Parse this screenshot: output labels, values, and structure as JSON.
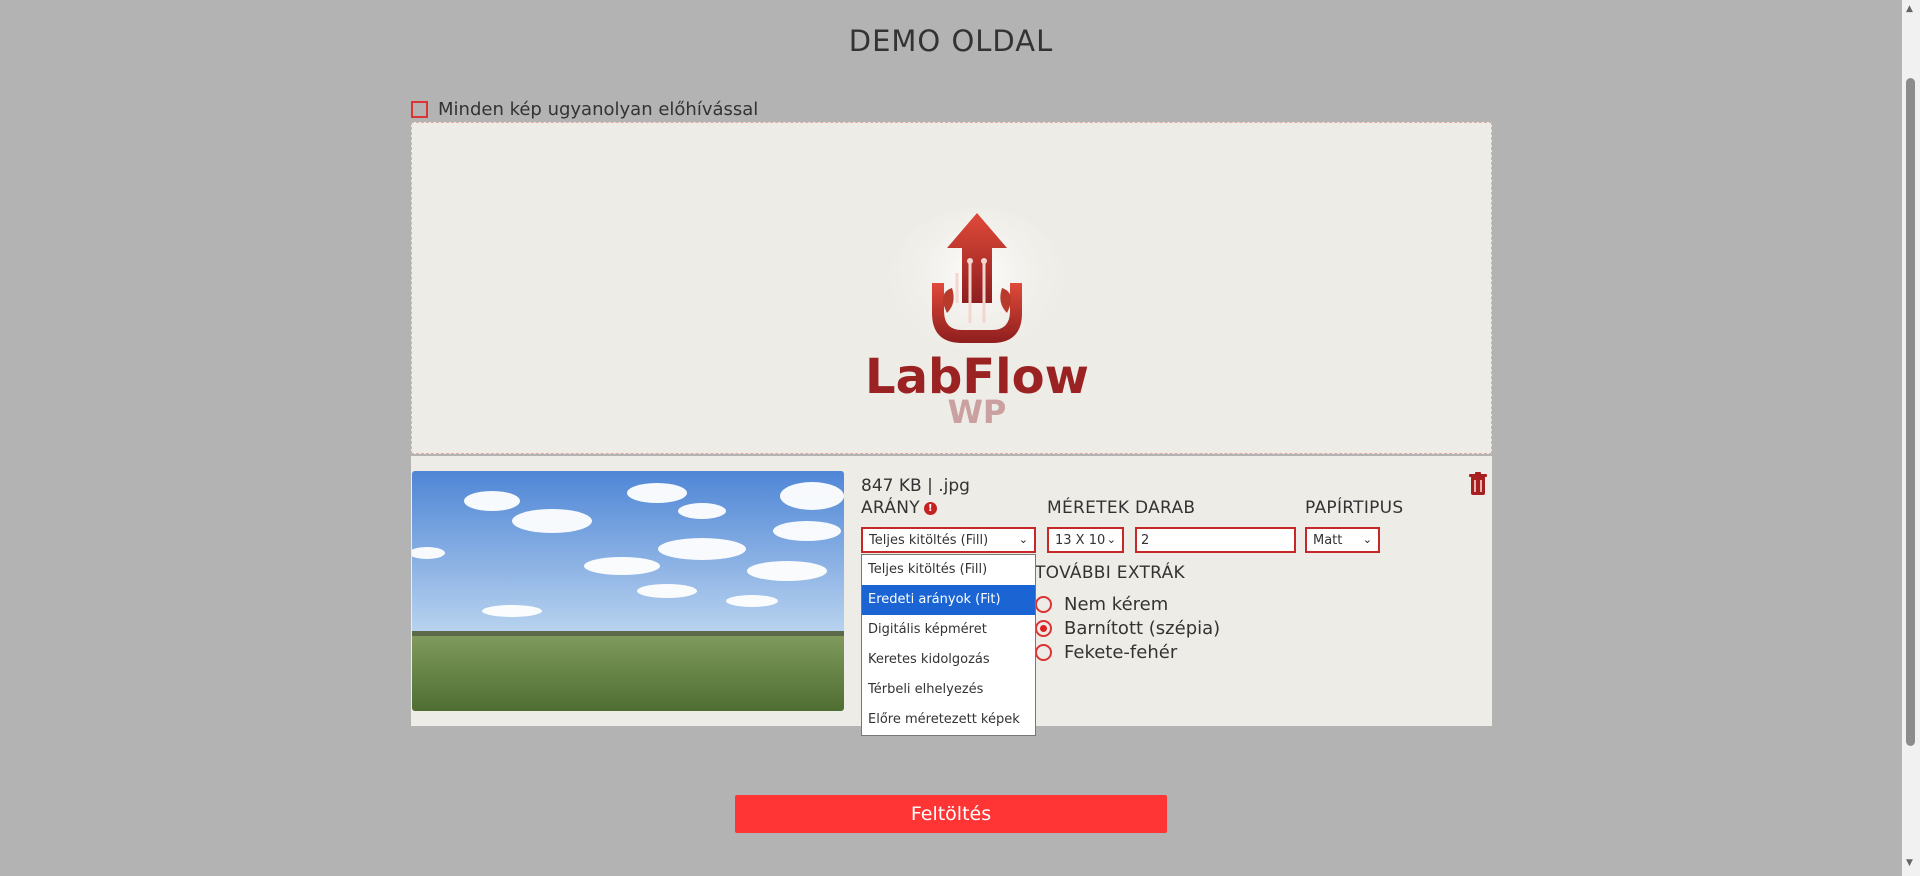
{
  "page": {
    "title": "DEMO OLDAL"
  },
  "options": {
    "same_development_label": "Minden kép ugyanolyan előhívással"
  },
  "dropzone": {
    "logo_text_main": "LabFlow",
    "logo_text_sub": "WP"
  },
  "item": {
    "fileinfo": "847 KB | .jpg",
    "ratio_label": "ARÁNY",
    "ratio_value": "Teljes kitöltés (Fill)",
    "size_label": "MÉRETEK",
    "size_value": "13 X 10",
    "qty_label": "DARAB",
    "qty_value": "2",
    "paper_label": "PAPÍRTIPUS",
    "paper_value": "Matt",
    "extras_label": "TOVÁBBI EXTRÁK",
    "extras": [
      "Nem kérem",
      "Barnított (szépia)",
      "Fekete-fehér"
    ],
    "extras_selected": 1
  },
  "dropdown": {
    "options": [
      "Teljes kitöltés (Fill)",
      "Eredeti arányok (Fit)",
      "Digitális képméret",
      "Keretes kidolgozás",
      "Térbeli elhelyezés",
      "Előre méretezett képek"
    ],
    "highlighted": 1
  },
  "actions": {
    "upload_label": "Feltöltés"
  },
  "icons": {
    "info": "info-icon",
    "delete": "trash-icon",
    "chevron": "chevron-down-icon"
  },
  "colors": {
    "accent": "#c62828",
    "button": "#ff3434",
    "panel": "#eeece6",
    "background": "#b3b3b3",
    "highlight": "#1a64d4"
  }
}
